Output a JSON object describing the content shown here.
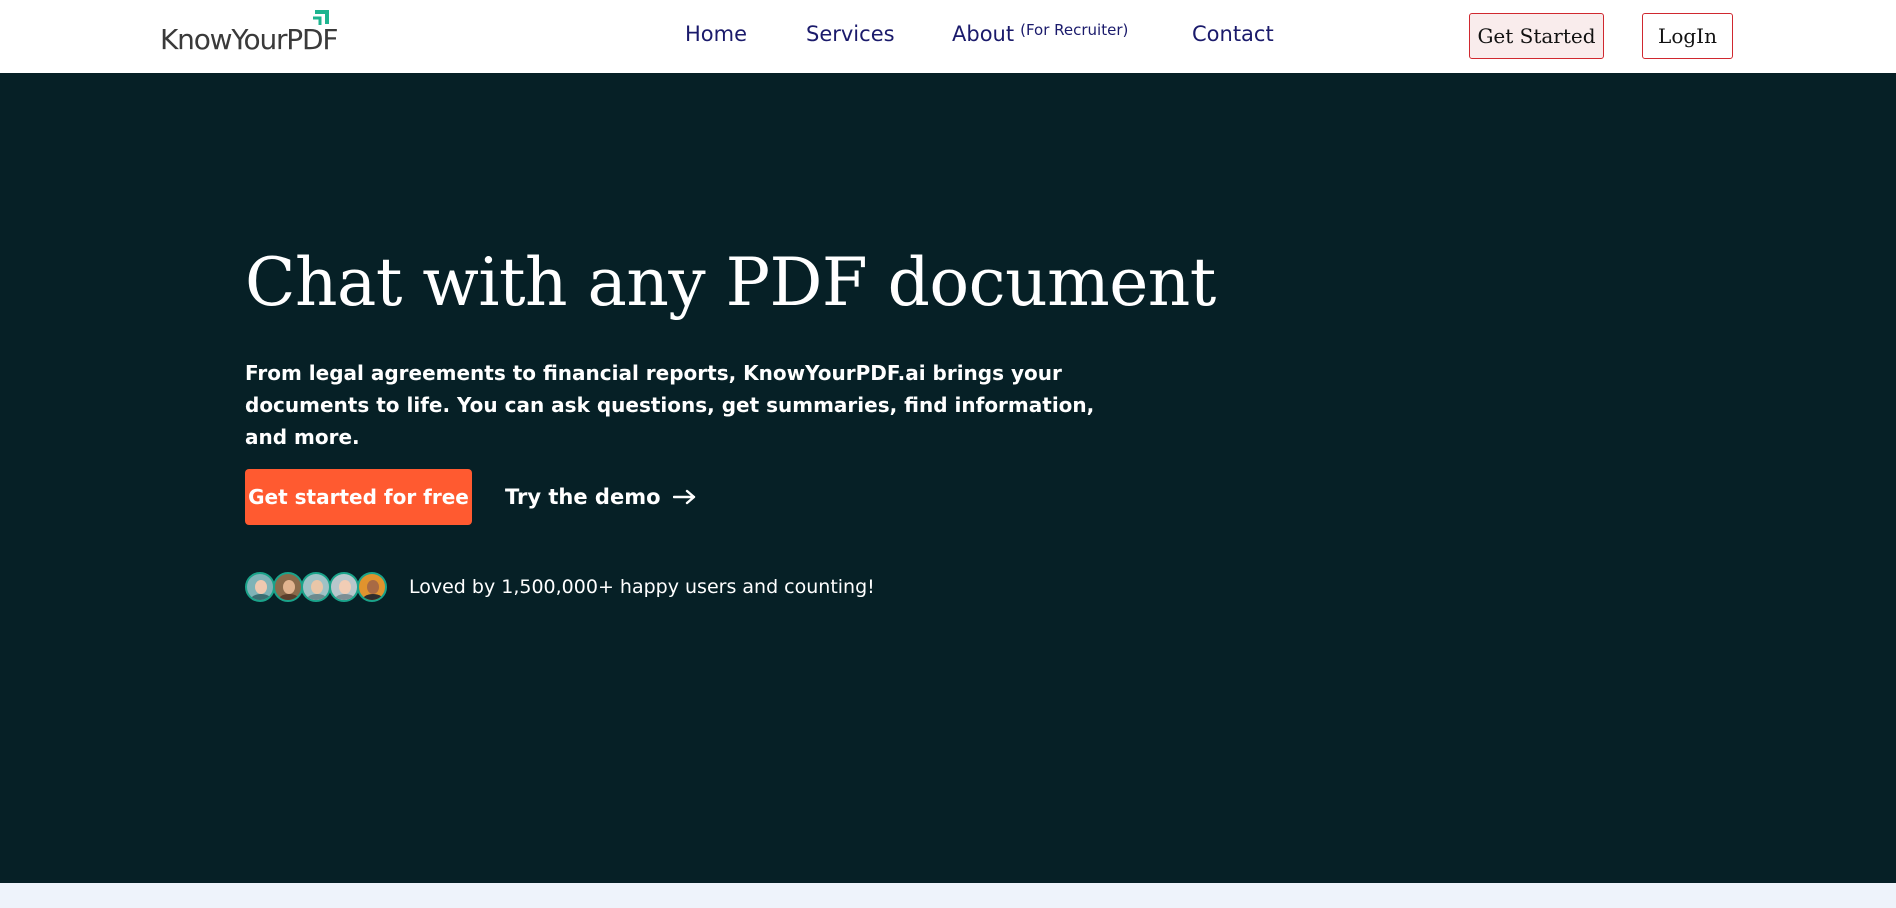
{
  "header": {
    "logo_text": "KnowYourPDF",
    "nav": {
      "home": "Home",
      "services": "Services",
      "about": "About",
      "about_suffix": "(For Recruiter)",
      "contact": "Contact"
    },
    "get_started_label": "Get Started",
    "login_label": "LogIn"
  },
  "hero": {
    "title": "Chat with any PDF document",
    "subtitle": "From legal agreements to financial reports, KnowYourPDF.ai brings your documents to life. You can ask questions, get summaries, find information, and more.",
    "primary_cta": "Get started for free",
    "demo_cta": "Try the demo",
    "social_proof": "Loved by 1,500,000+ happy users and counting!"
  },
  "icons": {
    "logo_mark": "arrow-up-right-icon",
    "demo_arrow": "arrow-right-icon",
    "avatars": [
      "avatar-icon",
      "avatar-icon",
      "avatar-icon",
      "avatar-icon",
      "avatar-icon"
    ]
  },
  "colors": {
    "hero_bg": "#062026",
    "primary_cta": "#ff5a30",
    "nav_text": "#1a1a6b",
    "logo_accent": "#1db48f",
    "header_button_border": "#d0282f",
    "page_bg_below": "#eef3fb"
  }
}
